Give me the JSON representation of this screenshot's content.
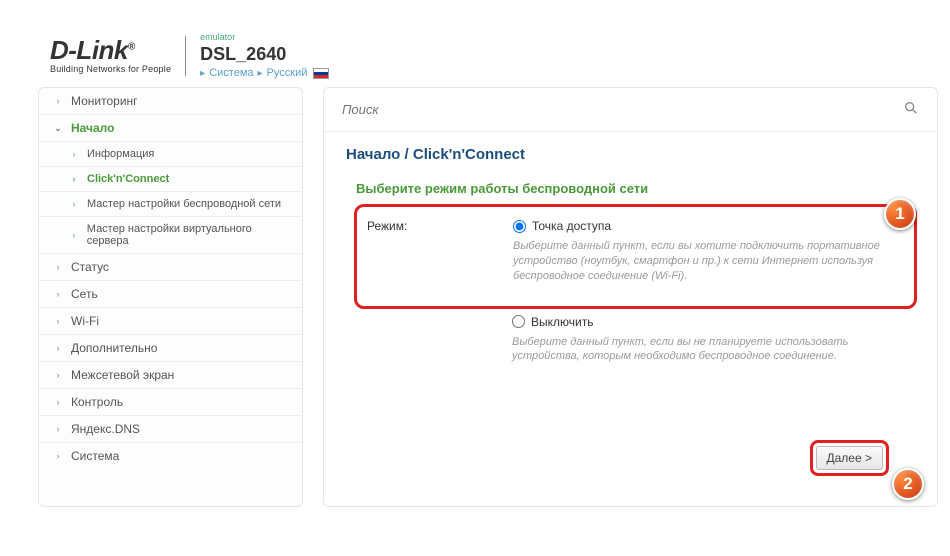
{
  "header": {
    "brand": "D-Link",
    "tagline": "Building Networks for People",
    "emulator": "emulator",
    "model": "DSL_2640",
    "crumb_system": "Система",
    "crumb_lang": "Русский"
  },
  "sidebar": {
    "items": [
      {
        "label": "Мониторинг",
        "active": false
      },
      {
        "label": "Начало",
        "active": true
      },
      {
        "label": "Информация",
        "sub": true,
        "active": false
      },
      {
        "label": "Click'n'Connect",
        "sub": true,
        "active": true
      },
      {
        "label": "Мастер настройки беспроводной сети",
        "sub": true,
        "active": false
      },
      {
        "label": "Мастер настройки виртуального сервера",
        "sub": true,
        "active": false
      },
      {
        "label": "Статус",
        "active": false
      },
      {
        "label": "Сеть",
        "active": false
      },
      {
        "label": "Wi-Fi",
        "active": false
      },
      {
        "label": "Дополнительно",
        "active": false
      },
      {
        "label": "Межсетевой экран",
        "active": false
      },
      {
        "label": "Контроль",
        "active": false
      },
      {
        "label": "Яндекс.DNS",
        "active": false
      },
      {
        "label": "Система",
        "active": false
      }
    ]
  },
  "search": {
    "placeholder": "Поиск"
  },
  "breadcrumb": {
    "root": "Начало",
    "sep": "/",
    "current": "Click'n'Connect"
  },
  "panel": {
    "title": "Выберите режим работы беспроводной сети",
    "mode_label": "Режим:",
    "option1": {
      "label": "Точка доступа",
      "desc": "Выберите данный пункт, если вы хотите подключить портативное устройство (ноутбук, смартфон и пр.) к сети Интернет используя беспроводное соединение (Wi-Fi)."
    },
    "option2": {
      "label": "Выключить",
      "desc": "Выберите данный пункт, если вы не планируете использовать устройства, которым необходимо беспроводное соединение."
    },
    "next": "Далее >"
  },
  "badges": {
    "one": "1",
    "two": "2"
  }
}
